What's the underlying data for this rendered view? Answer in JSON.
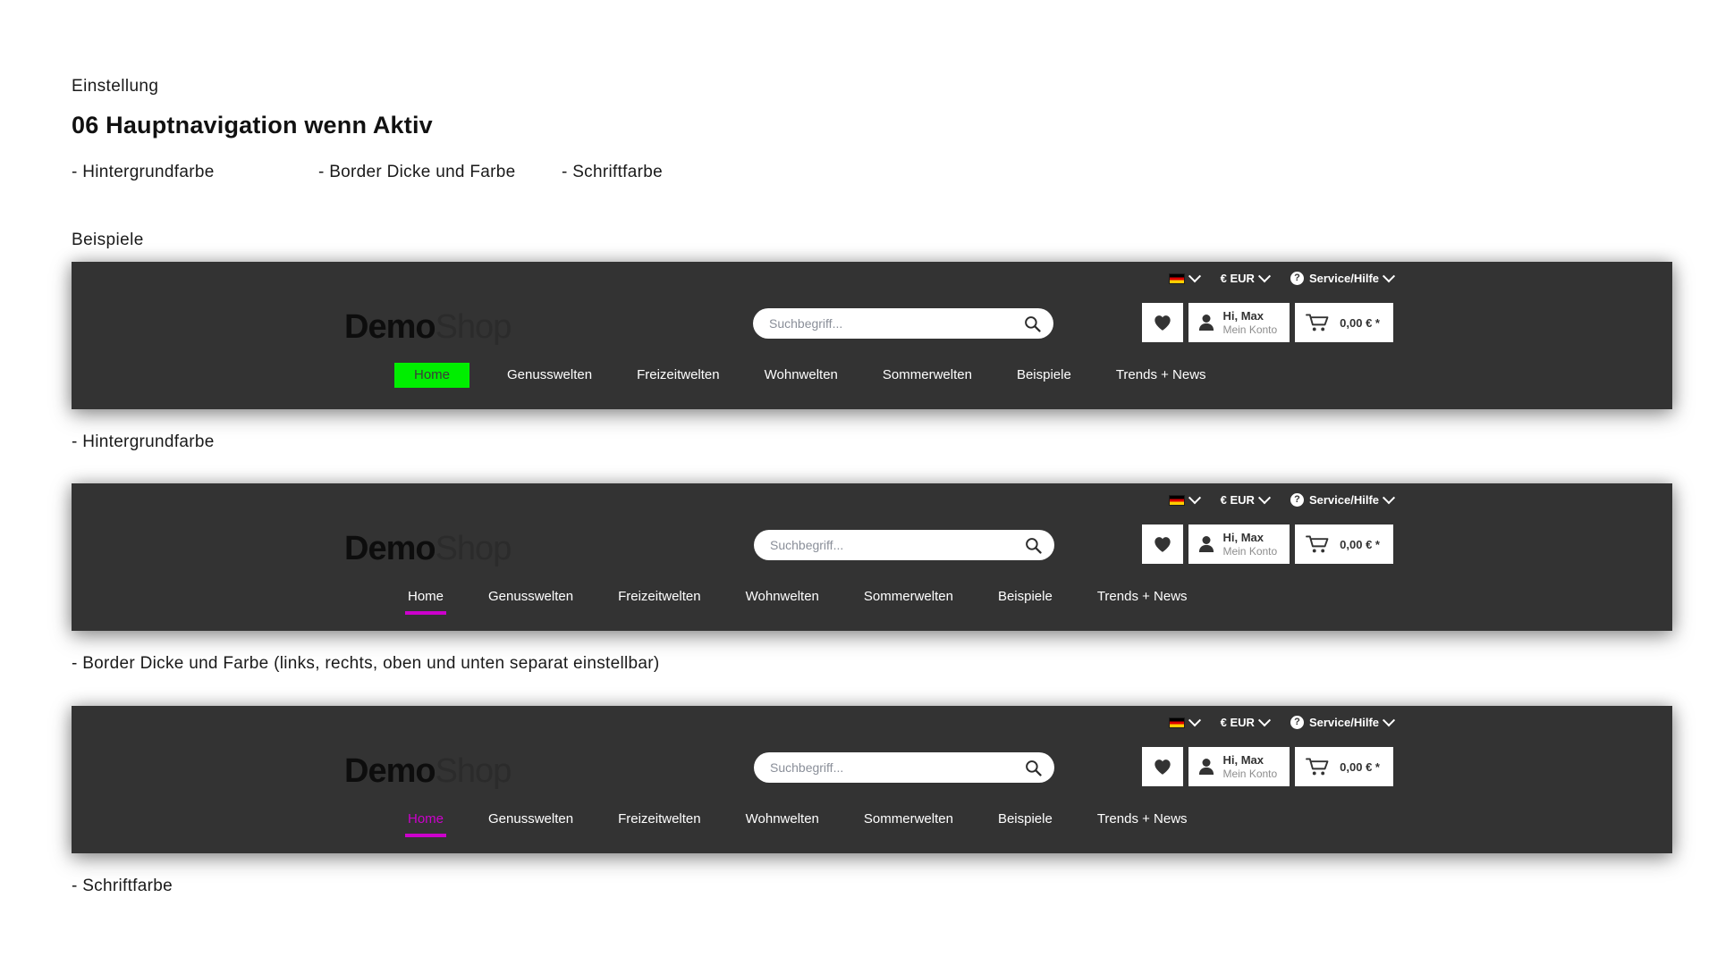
{
  "document": {
    "eyebrow": "Einstellung",
    "title": "06 Hauptnavigation wenn Aktiv",
    "bullets": [
      "- Hintergrundfarbe",
      "- Border Dicke und Farbe",
      "- Schriftfarbe"
    ],
    "examples_label": "Beispiele",
    "captions": [
      "- Hintergrundfarbe",
      "- Border Dicke und Farbe (links, rechts, oben und unten separat einstellbar)",
      "- Schriftfarbe"
    ]
  },
  "shop": {
    "logo": {
      "bold": "Demo",
      "light": "Shop"
    },
    "search": {
      "placeholder": "Suchbegriff...",
      "value": "",
      "icon": "search-icon"
    },
    "utility": {
      "language": {
        "label": "",
        "icon": "german-flag-icon",
        "chevron": "chevron-down-icon"
      },
      "currency": {
        "label": "€ EUR",
        "chevron": "chevron-down-icon"
      },
      "service": {
        "label": "Service/Hilfe",
        "icon": "question-mark-icon",
        "chevron": "chevron-down-icon"
      }
    },
    "actions": {
      "wishlist": {
        "icon": "heart-icon",
        "label": ""
      },
      "account": {
        "icon": "person-icon",
        "greeting": "Hi, Max",
        "sub": "Mein Konto"
      },
      "cart": {
        "icon": "shopping-cart-icon",
        "amount": "0,00 € *"
      }
    },
    "nav_items": [
      "Home",
      "Genusswelten",
      "Freizeitwelten",
      "Wohnwelten",
      "Sommerwelten",
      "Beispiele",
      "Trends + News"
    ],
    "active_index": 0
  },
  "colors": {
    "header_background": "#333333",
    "active_background": "#00ee00",
    "active_text_dark": "#3b3b3b",
    "active_border": "#cc00cc",
    "active_font": "#cc00cc",
    "nav_text": "#ffffff",
    "page_background": "#ffffff"
  },
  "variants": [
    {
      "name": "hintergrundfarbe",
      "active_style": "background"
    },
    {
      "name": "border-dicke-und-farbe",
      "active_style": "border"
    },
    {
      "name": "schriftfarbe",
      "active_style": "font-color"
    }
  ]
}
